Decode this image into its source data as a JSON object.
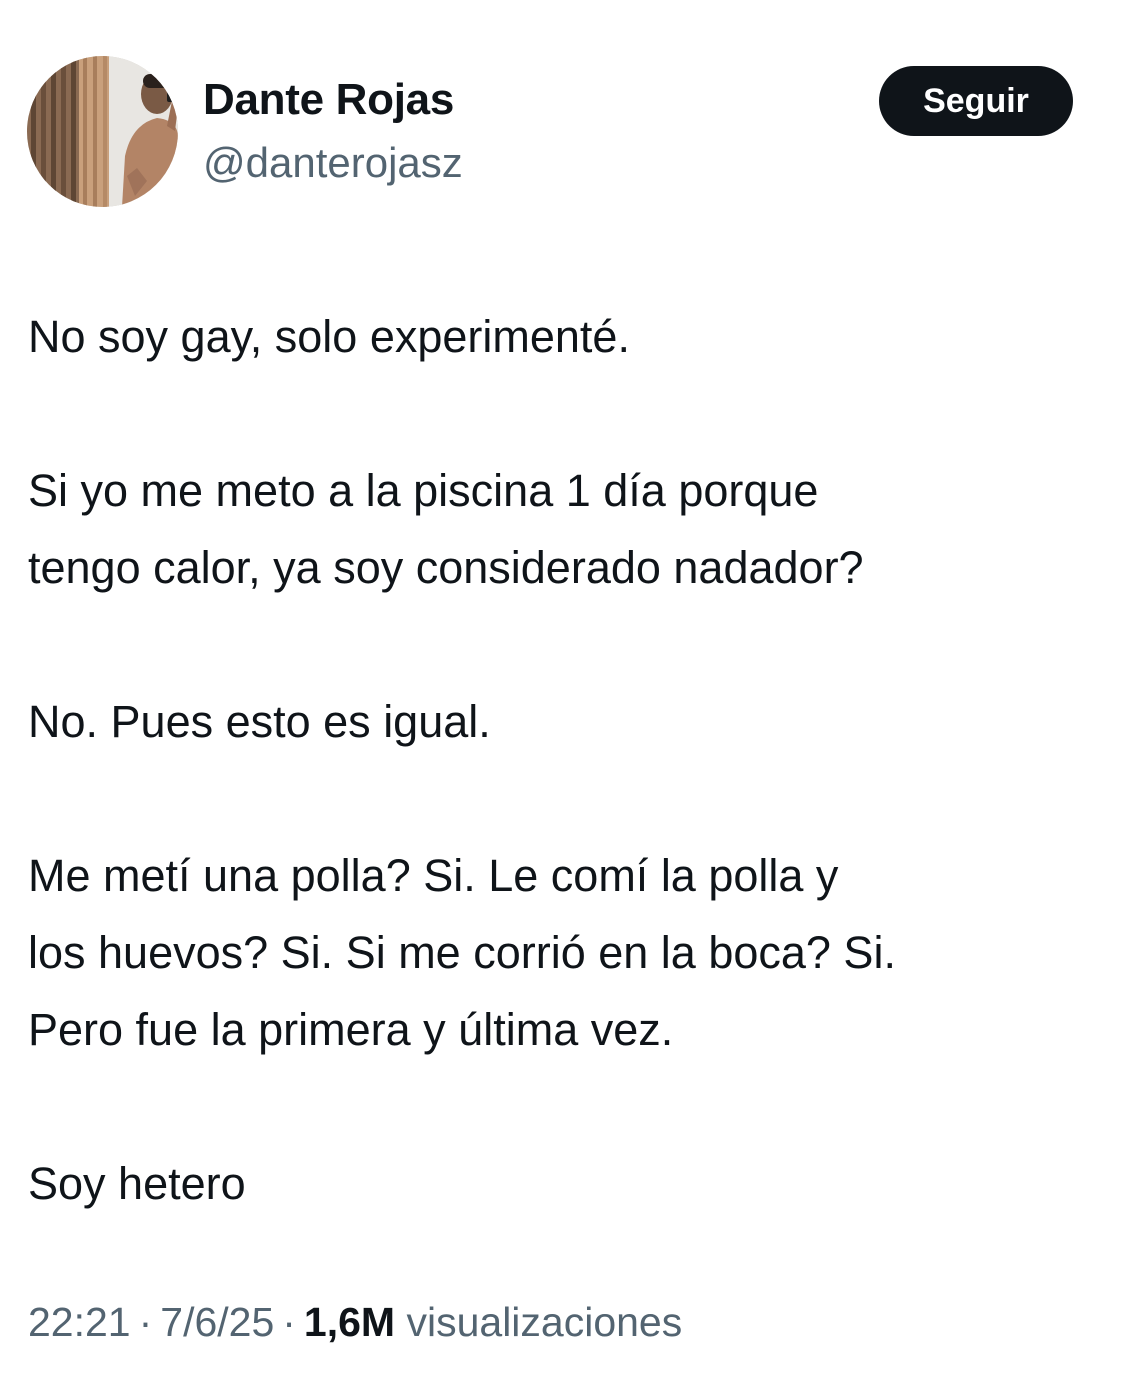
{
  "author": {
    "display_name": "Dante Rojas",
    "handle": "@danterojasz",
    "avatar_icon": "profile-photo-avatar"
  },
  "follow_button": {
    "label": "Seguir"
  },
  "tweet": {
    "paragraphs": [
      [
        "No soy gay, solo experimenté."
      ],
      [
        "Si yo me meto a la piscina 1 día porque",
        "tengo calor, ya soy considerado nadador?"
      ],
      [
        "No. Pues esto es igual."
      ],
      [
        "Me metí una polla? Si. Le comí la polla y",
        "los huevos? Si. Si me corrió en la boca? Si.",
        "Pero fue la primera y última vez."
      ],
      [
        "Soy hetero"
      ]
    ]
  },
  "meta": {
    "time": "22:21",
    "date": "7/6/25",
    "separator": "·",
    "views_count": "1,6M",
    "views_label": "visualizaciones"
  },
  "colors": {
    "text_primary": "#0f1419",
    "text_secondary": "#536471",
    "button_bg": "#0f1419",
    "button_text": "#ffffff",
    "background": "#ffffff"
  }
}
